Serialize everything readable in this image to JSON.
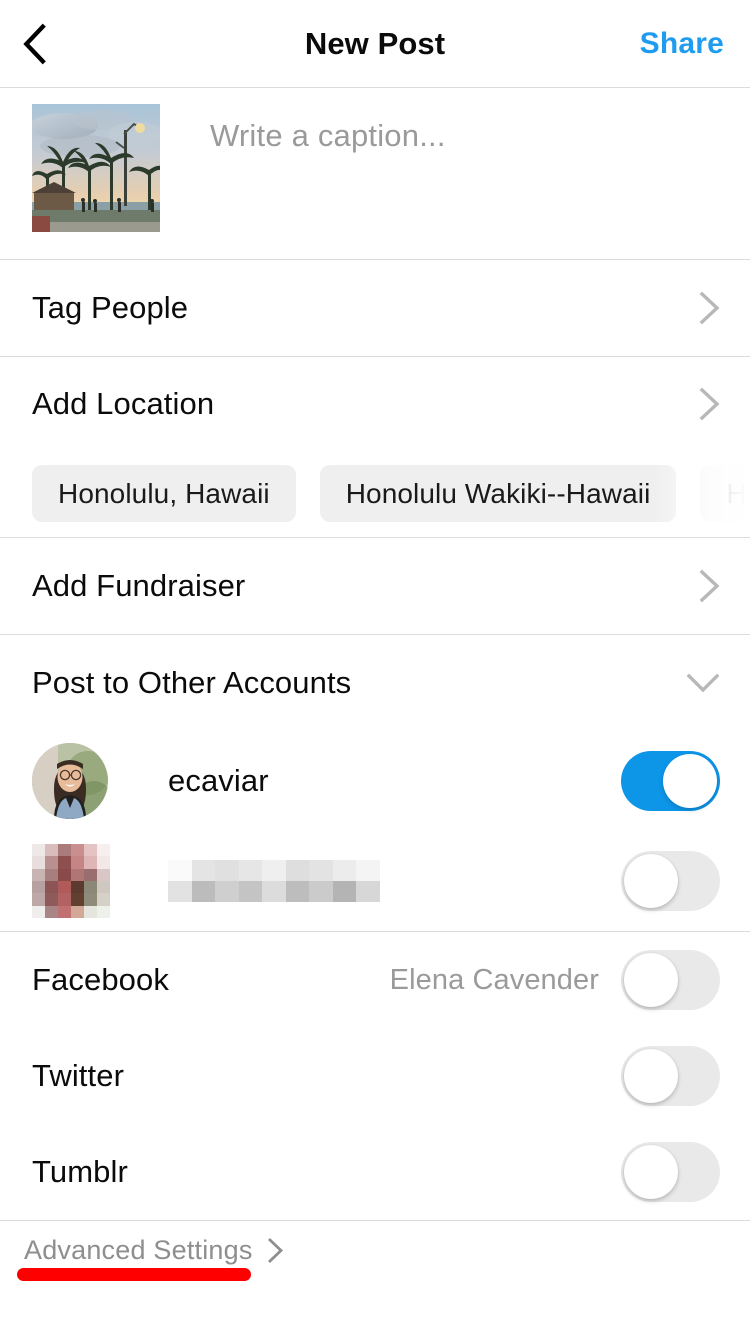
{
  "header": {
    "back_icon": "chevron-left-icon",
    "title": "New Post",
    "share_label": "Share"
  },
  "caption": {
    "placeholder": "Write a caption...",
    "value": "",
    "thumbnail_alt": "beach sunset with palm trees and street lamp"
  },
  "options": [
    {
      "label": "Tag People",
      "chevron": "chevron-right-icon"
    },
    {
      "label": "Add Location",
      "chevron": "chevron-right-icon"
    },
    {
      "label": "Add Fundraiser",
      "chevron": "chevron-right-icon"
    }
  ],
  "location_suggestions": [
    {
      "label": "Honolulu, Hawaii"
    },
    {
      "label": "Honolulu Wakiki--Hawaii"
    },
    {
      "label": "Honolulu -"
    }
  ],
  "post_to_other_accounts": {
    "label": "Post to Other Accounts",
    "chevron": "chevron-down-icon",
    "accounts": [
      {
        "name": "ecaviar",
        "enabled": true,
        "redacted": false
      },
      {
        "name": "",
        "enabled": false,
        "redacted": true
      }
    ]
  },
  "social_networks": [
    {
      "label": "Facebook",
      "value": "Elena Cavender",
      "enabled": false
    },
    {
      "label": "Twitter",
      "value": "",
      "enabled": false
    },
    {
      "label": "Tumblr",
      "value": "",
      "enabled": false
    }
  ],
  "footer": {
    "advanced_settings_label": "Advanced Settings",
    "advanced_settings_chevron": "chevron-right-icon",
    "annotation_color": "#ff0000"
  },
  "colors": {
    "accent_blue": "#0d95e8",
    "share_blue": "#1f9cf0",
    "divider": "#dcdcdc",
    "chip_bg": "#efeff0",
    "switch_off": "#e9e9ea",
    "muted_text": "#9a9a9a"
  }
}
